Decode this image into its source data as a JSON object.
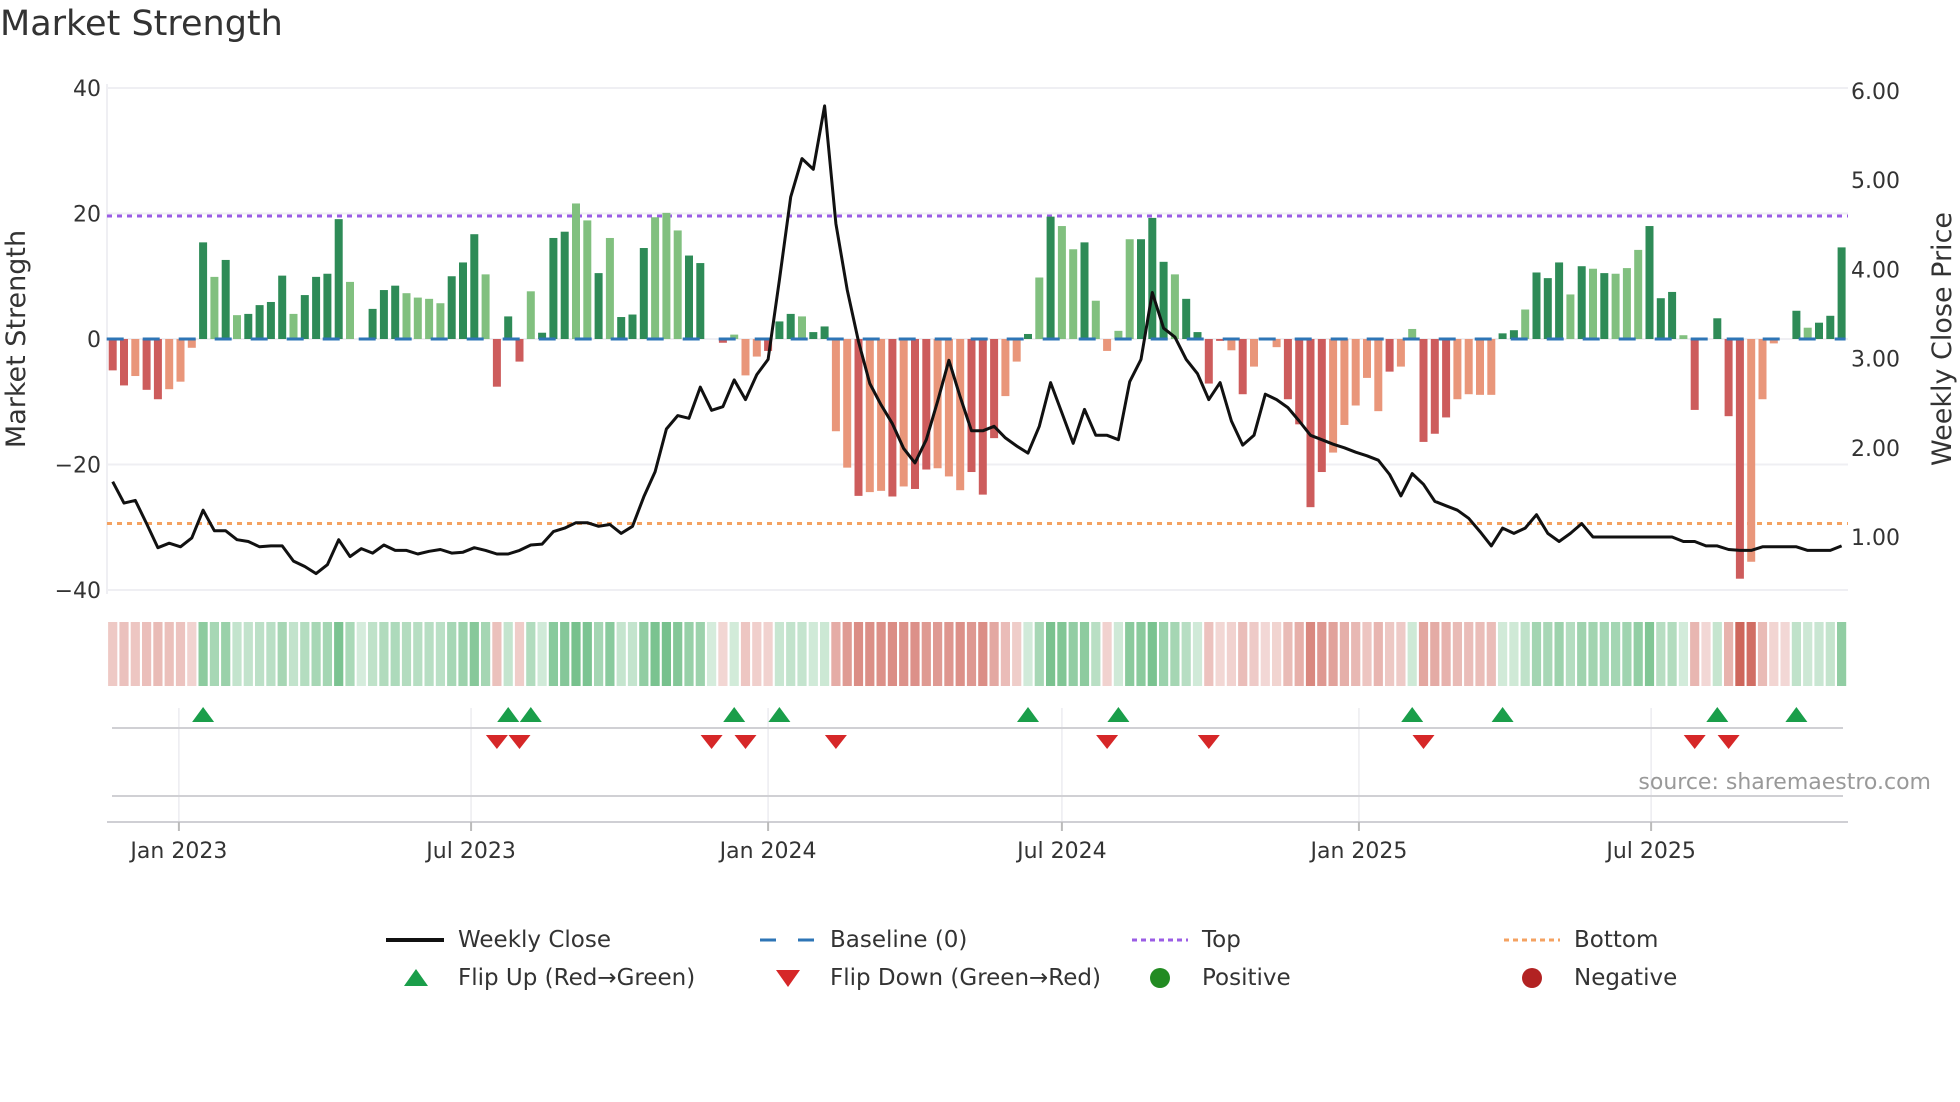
{
  "title": "Market Strength",
  "source": "source: sharemaestro.com",
  "colors": {
    "price_line": "#111111",
    "baseline": "#2e75b6",
    "top": "#9b5de5",
    "bottom": "#f4a261",
    "pos_strong": "#2e8b57",
    "pos_weak": "#81c07f",
    "neg_strong": "#cd5c5c",
    "neg_weak": "#e9967a",
    "flip_up": "#1a9e4a",
    "flip_down": "#d62728",
    "positive": "#228b22",
    "negative": "#b22222"
  },
  "chart_data": {
    "type": "bar",
    "title": "Market Strength",
    "ylabel": "Market Strength",
    "y2label": "Weekly Close Price",
    "ylim": [
      -40,
      40
    ],
    "y2lim": [
      0.32,
      6.0
    ],
    "yticks": [
      "40",
      "20",
      "0",
      "−20",
      "−40"
    ],
    "ytick_values": [
      40,
      20,
      0,
      -20,
      -40
    ],
    "y2ticks": [
      "6.00",
      "5.00",
      "4.00",
      "3.00",
      "2.00",
      "1.00"
    ],
    "y2tick_values": [
      6,
      5,
      4,
      3,
      2,
      1
    ],
    "x_start": "2022-11-21",
    "x_step_days": 7,
    "xticks": [
      {
        "label": "Jan 2023",
        "date": "2023-01-01"
      },
      {
        "label": "Jul 2023",
        "date": "2023-07-01"
      },
      {
        "label": "Jan 2024",
        "date": "2024-01-01"
      },
      {
        "label": "Jul 2024",
        "date": "2024-07-01"
      },
      {
        "label": "Jan 2025",
        "date": "2025-01-01"
      },
      {
        "label": "Jul 2025",
        "date": "2025-07-01"
      }
    ],
    "top_level": 19.6,
    "bottom_level": -29.4,
    "baseline": 0,
    "strength": [
      -5.0,
      -7.4,
      -5.9,
      -8.1,
      -9.6,
      -8.0,
      -6.8,
      -1.4,
      15.4,
      9.9,
      12.6,
      3.8,
      4.0,
      5.4,
      5.9,
      10.1,
      4.0,
      7.0,
      9.9,
      10.4,
      19.1,
      9.1,
      0,
      4.8,
      7.8,
      8.5,
      7.3,
      6.6,
      6.4,
      5.7,
      10.0,
      12.2,
      16.7,
      10.3,
      -7.6,
      3.6,
      -3.6,
      7.6,
      1.0,
      16.1,
      17.1,
      21.6,
      18.9,
      10.5,
      16.1,
      3.5,
      3.9,
      14.5,
      19.4,
      20.1,
      17.3,
      13.3,
      12.1,
      0,
      -0.6,
      0.7,
      -5.8,
      -2.8,
      -1.9,
      2.8,
      4.0,
      3.6,
      1.1,
      2.0,
      -14.7,
      -20.5,
      -25.0,
      -24.4,
      -24.2,
      -25.1,
      -23.5,
      -23.9,
      -20.8,
      -20.6,
      -21.9,
      -24.1,
      -21.2,
      -24.8,
      -15.8,
      -9.1,
      -3.6,
      0.8,
      9.8,
      19.5,
      18.0,
      14.3,
      15.4,
      6.1,
      -1.9,
      1.3,
      15.9,
      15.9,
      19.3,
      12.3,
      10.3,
      6.4,
      1.1,
      -7.1,
      -0.3,
      -1.8,
      -8.8,
      -4.4,
      0,
      -1.3,
      -9.6,
      -13.6,
      -26.8,
      -21.2,
      -18.1,
      -13.7,
      -10.6,
      -6.2,
      -11.5,
      -5.2,
      -4.4,
      1.6,
      -16.4,
      -15.1,
      -12.5,
      -9.6,
      -8.8,
      -8.9,
      -8.9,
      0.9,
      1.4,
      4.7,
      10.6,
      9.7,
      12.2,
      7.1,
      11.6,
      11.2,
      10.5,
      10.4,
      11.3,
      14.2,
      18.0,
      6.5,
      7.5,
      0.6,
      -11.3,
      0,
      3.3,
      -12.3,
      -38.2,
      -35.5,
      -9.6,
      -0.7,
      0,
      4.5,
      1.8,
      2.6,
      3.7,
      14.6
    ],
    "strong": "ddlddllldldlddddlddddl-dddlllldddldddldddlldldddllll-ddd",
    "strength_shade": "ddlddllldldlddddlddddl-dddlllldddldddldddlldldddlll-dddllldddlddlldlldlddllldddlldldlldlllldddlddd-ldldl-dddllllldlldddllllddldddldldllldddldl-ddlll-dldd",
    "weekly_close": [
      1.62,
      1.38,
      1.41,
      1.15,
      0.88,
      0.93,
      0.89,
      0.99,
      1.3,
      1.07,
      1.07,
      0.97,
      0.95,
      0.89,
      0.9,
      0.9,
      0.73,
      0.67,
      0.59,
      0.69,
      0.97,
      0.78,
      0.87,
      0.82,
      0.91,
      0.85,
      0.85,
      0.81,
      0.84,
      0.86,
      0.82,
      0.83,
      0.88,
      0.85,
      0.81,
      0.81,
      0.85,
      0.91,
      0.92,
      1.06,
      1.1,
      1.16,
      1.16,
      1.12,
      1.14,
      1.04,
      1.12,
      1.45,
      1.73,
      2.21,
      2.36,
      2.33,
      2.68,
      2.42,
      2.46,
      2.76,
      2.54,
      2.82,
      2.99,
      3.88,
      4.81,
      5.24,
      5.12,
      5.83,
      4.51,
      3.77,
      3.19,
      2.72,
      2.48,
      2.27,
      1.99,
      1.83,
      2.09,
      2.52,
      2.98,
      2.57,
      2.19,
      2.19,
      2.24,
      2.11,
      2.02,
      1.94,
      2.24,
      2.73,
      2.39,
      2.05,
      2.43,
      2.14,
      2.14,
      2.09,
      2.74,
      2.99,
      3.74,
      3.34,
      3.24,
      2.99,
      2.83,
      2.54,
      2.73,
      2.3,
      2.03,
      2.14,
      2.6,
      2.54,
      2.45,
      2.3,
      2.14,
      2.09,
      2.04,
      2.0,
      1.95,
      1.91,
      1.86,
      1.7,
      1.46,
      1.71,
      1.59,
      1.4,
      1.35,
      1.3,
      1.21,
      1.06,
      0.9,
      1.1,
      1.04,
      1.1,
      1.25,
      1.04,
      0.95,
      1.04,
      1.15,
      1.0,
      1.0,
      1.0,
      1.0,
      1.0,
      1.0,
      1.0,
      1.0,
      0.95,
      0.95,
      0.9,
      0.9,
      0.86,
      0.85,
      0.85,
      0.89,
      0.89,
      0.89,
      0.89,
      0.85,
      0.85,
      0.85,
      0.9
    ],
    "flip_up_weeks": [
      9,
      36,
      38,
      56,
      60,
      82,
      90,
      116,
      124,
      143,
      150
    ],
    "flip_down_weeks": [
      35,
      37,
      54,
      57,
      65,
      89,
      98,
      117,
      141,
      144
    ],
    "legend_position": "bottom"
  },
  "legend": {
    "weekly_close": "Weekly Close",
    "baseline": "Baseline (0)",
    "top": "Top",
    "bottom": "Bottom",
    "flip_up": "Flip Up (Red→Green)",
    "flip_down": "Flip Down (Green→Red)",
    "positive": "Positive",
    "negative": "Negative"
  }
}
